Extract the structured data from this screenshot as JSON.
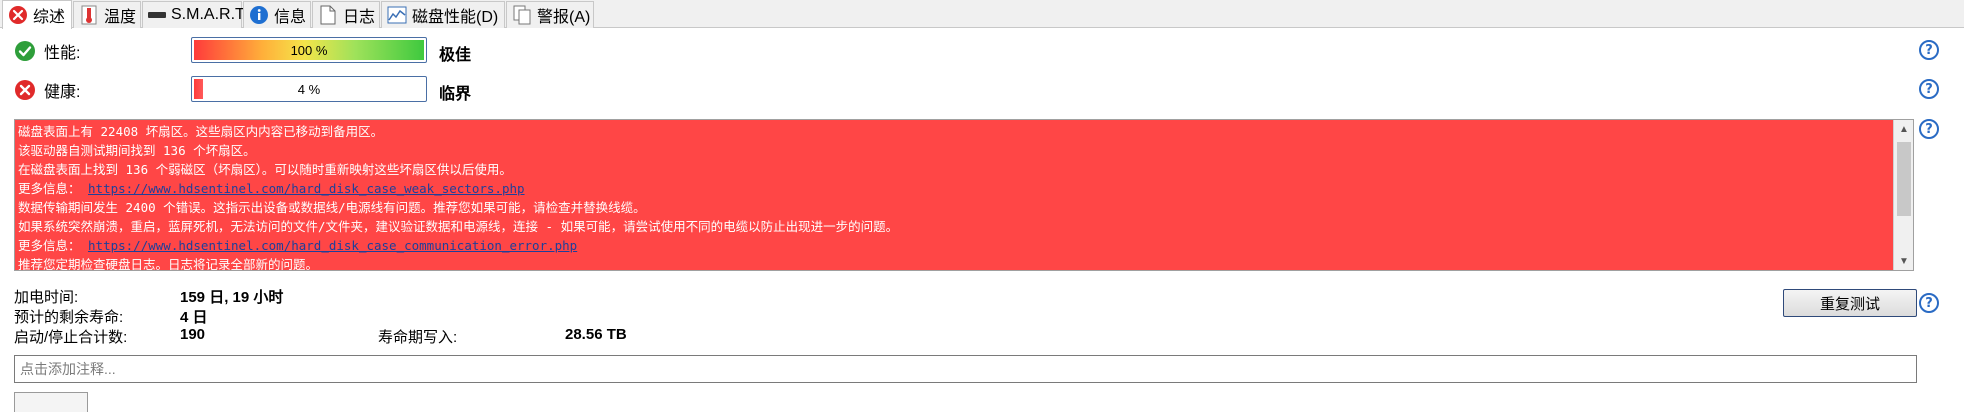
{
  "tabs": [
    {
      "label": "综述",
      "icon": "error-icon"
    },
    {
      "label": "温度",
      "icon": "thermometer-icon"
    },
    {
      "label": "S.M.A.R.T.",
      "icon": "drive-icon"
    },
    {
      "label": "信息",
      "icon": "info-icon"
    },
    {
      "label": "日志",
      "icon": "document-icon"
    },
    {
      "label": "磁盘性能(D)",
      "icon": "performance-chart-icon"
    },
    {
      "label": "警报(A)",
      "icon": "alert-documents-icon"
    }
  ],
  "performance": {
    "label": "性能:",
    "bar_text": "100 %",
    "percent": 100,
    "rating": "极佳"
  },
  "health": {
    "label": "健康:",
    "bar_text": "4 %",
    "percent": 4,
    "rating": "临界"
  },
  "log": {
    "lines": [
      {
        "text": "磁盘表面上有 22408 坏扇区。这些扇区内内容已移动到备用区。"
      },
      {
        "text": "该驱动器自测试期间找到 136 个坏扇区。"
      },
      {
        "text": "在磁盘表面上找到 136 个弱磁区（坏扇区）。可以随时重新映射这些坏扇区供以后使用。"
      },
      {
        "text": "更多信息： ",
        "link": "https://www.hdsentinel.com/hard_disk_case_weak_sectors.php"
      },
      {
        "text": "数据传输期间发生 2400 个错误。这指示出设备或数据线/电源线有问题。推荐您如果可能，请检查并替换线缆。"
      },
      {
        "text": "如果系统突然崩溃，重启，蓝屏死机，无法访问的文件/文件夹，建议验证数据和电源线，连接 - 如果可能，请尝试使用不同的电缆以防止出现进一步的问题。"
      },
      {
        "text": "更多信息： ",
        "link": "https://www.hdsentinel.com/hard_disk_case_communication_error.php"
      },
      {
        "text": "推荐您定期检查硬盘日志。日志将记录全部新的问题。"
      }
    ]
  },
  "stats": {
    "power_on_label": "加电时间:",
    "power_on_value": "159 日, 19 小时",
    "remaining_label": "预计的剩余寿命:",
    "remaining_value": "4 日",
    "startstop_label": "启动/停止合计数:",
    "startstop_value": "190",
    "lifetime_writes_label": "寿命期写入:",
    "lifetime_writes_value": "28.56 TB"
  },
  "retest_button": "重复测试",
  "note_placeholder": "点击添加注释...",
  "help_symbol": "?",
  "colors": {
    "log_background": "#ff4646",
    "ok_green": "#2e9e3a",
    "error_red": "#e02a2a",
    "link": "#1e3f9a"
  }
}
